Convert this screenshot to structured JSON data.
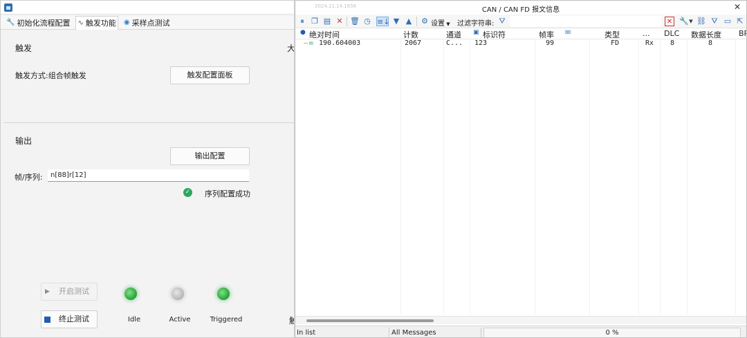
{
  "left_panel": {
    "tabs": [
      {
        "label": "初始化流程配置"
      },
      {
        "label": "触发功能"
      },
      {
        "label": "采样点测试"
      }
    ],
    "clipped_right_glyph": "大",
    "clipped_bottom_glyph": "触",
    "trigger": {
      "title": "触发",
      "mode_label": "触发方式:组合帧触发",
      "config_button": "触发配置面板"
    },
    "output": {
      "title": "输出",
      "config_button": "输出配置",
      "sequence_label": "帧/序列:",
      "sequence_value": "n[88]r[12]",
      "status_text": "序列配置成功"
    },
    "controls": {
      "start_button": "开启测试",
      "stop_button": "终止测试"
    },
    "indicators": [
      {
        "label": "Idle",
        "state": "green"
      },
      {
        "label": "Active",
        "state": "grey"
      },
      {
        "label": "Triggered",
        "state": "green"
      }
    ]
  },
  "right_panel": {
    "title": "CAN / CAN FD 报文信息",
    "faint_timestamp": "2024.11.14.1656",
    "toolbar": {
      "settings_label": "设置",
      "filter_label": "过滤字符串:"
    },
    "columns": [
      "绝对时间",
      "计数",
      "通道",
      "标识符",
      "帧率",
      "类型",
      "...",
      "DLC",
      "数据长度",
      "BR"
    ],
    "rows": [
      {
        "time": "190.604003",
        "count": "2067",
        "channel": "C...",
        "id": "123",
        "rate": "99",
        "type": "FD",
        "dir": "Rx",
        "dlc": "8",
        "len": "8"
      }
    ],
    "status": {
      "in_list": "In list",
      "all_messages": "All Messages",
      "progress": "0 %"
    }
  },
  "colors": {
    "led_green": "#2aa63a",
    "led_grey": "#b9b9b9",
    "accent_blue": "#2f6fb3",
    "delete_red": "#d23131",
    "success_green": "#2aa85f"
  }
}
